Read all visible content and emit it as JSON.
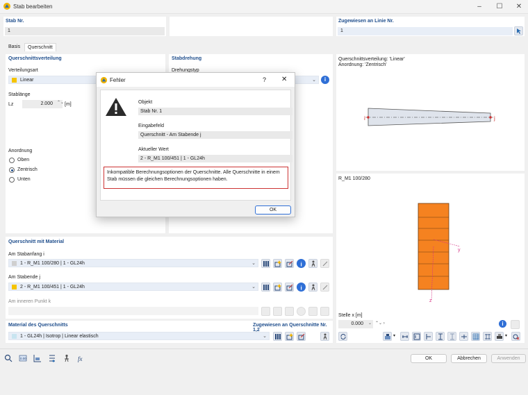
{
  "window": {
    "title": "Stab bearbeiten"
  },
  "member": {
    "label": "Stab Nr.",
    "value": "1"
  },
  "assigned_line": {
    "label": "Zugewiesen an Linie Nr.",
    "value": "1"
  },
  "tabs": [
    {
      "label": "Basis"
    },
    {
      "label": "Querschnitt"
    }
  ],
  "distribution": {
    "heading": "Querschnittsverteilung",
    "type_label": "Verteilungsart",
    "type_value": "Linear",
    "length_label": "Stablänge",
    "lz_label": "Lz",
    "lz_value": "2.000",
    "lz_unit": "[m]",
    "arrangement_label": "Anordnung",
    "options": [
      "Oben",
      "Zentrisch",
      "Unten"
    ],
    "selected": "Zentrisch"
  },
  "rotation": {
    "heading": "Stabdrehung",
    "type_label": "Drehungstyp"
  },
  "preview_top": {
    "line1": "Querschnittsverteilung: 'Linear'",
    "line2": "Anordnung: 'Zentrisch'",
    "start": "i",
    "end": "j"
  },
  "preview_bottom": {
    "title": "R_M1 100/280",
    "y_axis": "y",
    "z_axis": "z"
  },
  "section_material": {
    "heading": "Querschnitt mit Material",
    "start_label": "Am Stabanfang i",
    "start_value": "1 - R_M1 100/280 | 1 - GL24h",
    "end_label": "Am Stabende j",
    "end_value": "2 - R_M1 100/451 | 1 - GL24h",
    "inner_label": "Am inneren Punkt k"
  },
  "material": {
    "heading": "Material des Querschnitts",
    "assigned_label": "Zugewiesen an Querschnitte Nr. 1,2",
    "value": "1 - GL24h | Isotrop | Linear elastisch"
  },
  "location": {
    "label": "Stelle x [m]",
    "value": "0.000"
  },
  "buttons": {
    "ok": "OK",
    "cancel": "Abbrechen",
    "apply": "Anwenden"
  },
  "error_dialog": {
    "title": "Fehler",
    "help": "?",
    "object_label": "Objekt",
    "object_value": "Stab Nr. 1",
    "input_label": "Eingabefeld",
    "input_value": "Querschnitt - Am Stabende j",
    "current_label": "Aktueller Wert",
    "current_value": "2 - R_M1 100/451 | 1 - GL24h",
    "message": "Inkompatible Berechnungsoptionen der Querschnitte. Alle Querschnitte in einem Stab müssen die gleichen Berechnungsoptionen haben.",
    "ok": "OK"
  },
  "colors": {
    "accent": "#1f4e8c",
    "section": "#f58220",
    "error": "#cc3333",
    "swatch": "#f5c400"
  }
}
